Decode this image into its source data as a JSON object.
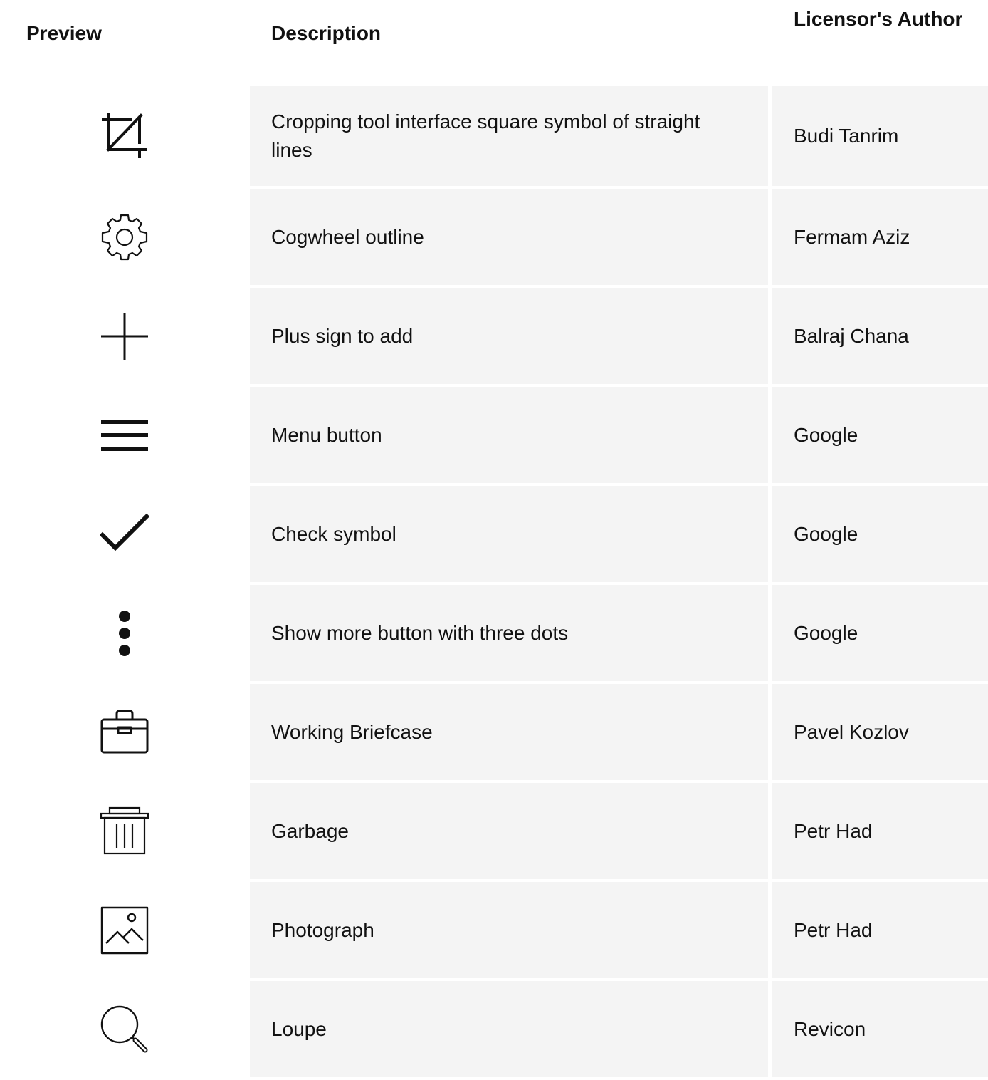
{
  "table": {
    "headers": {
      "preview": "Preview",
      "description": "Description",
      "author": "Licensor's Author"
    },
    "rows": [
      {
        "icon": "crop-icon",
        "description": "Cropping tool interface square symbol of straight lines",
        "author": "Budi Tanrim"
      },
      {
        "icon": "cogwheel-icon",
        "description": "Cogwheel outline",
        "author": "Fermam Aziz"
      },
      {
        "icon": "plus-icon",
        "description": "Plus sign to add",
        "author": "Balraj Chana"
      },
      {
        "icon": "menu-icon",
        "description": "Menu button",
        "author": "Google"
      },
      {
        "icon": "check-icon",
        "description": "Check symbol",
        "author": "Google"
      },
      {
        "icon": "more-vertical-icon",
        "description": "Show more button with three dots",
        "author": "Google"
      },
      {
        "icon": "briefcase-icon",
        "description": "Working Briefcase",
        "author": "Pavel Kozlov"
      },
      {
        "icon": "trash-icon",
        "description": "Garbage",
        "author": "Petr Had"
      },
      {
        "icon": "photo-icon",
        "description": "Photograph",
        "author": "Petr Had"
      },
      {
        "icon": "magnifier-icon",
        "description": "Loupe",
        "author": "Revicon"
      }
    ]
  },
  "colors": {
    "cell_background": "#f4f4f4",
    "text": "#111111",
    "icon": "#111111"
  }
}
